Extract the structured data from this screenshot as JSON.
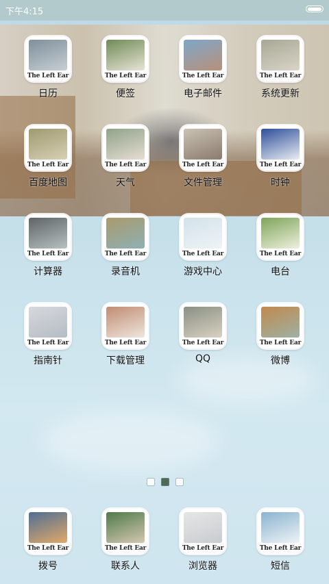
{
  "status_bar": {
    "time": "下午4:15"
  },
  "icon_caption": "The Left Ear",
  "apps": [
    {
      "id": "calendar",
      "label": "日历",
      "photo": [
        "#7f8f9a",
        "#c7cfd4"
      ]
    },
    {
      "id": "notes",
      "label": "便签",
      "photo": [
        "#6f8b56",
        "#e8e4d6"
      ]
    },
    {
      "id": "email",
      "label": "电子邮件",
      "photo": [
        "#7ea7c8",
        "#b9907a"
      ]
    },
    {
      "id": "system-update",
      "label": "系统更新",
      "photo": [
        "#a8a896",
        "#d8d4c6"
      ]
    },
    {
      "id": "baidu-map",
      "label": "百度地图",
      "photo": [
        "#a09a72",
        "#d7cfb4"
      ]
    },
    {
      "id": "weather",
      "label": "天气",
      "photo": [
        "#8fa38a",
        "#e6ddd2"
      ]
    },
    {
      "id": "file-manager",
      "label": "文件管理",
      "photo": [
        "#c9c2b4",
        "#8a7b6e"
      ]
    },
    {
      "id": "clock",
      "label": "时钟",
      "photo": [
        "#2e4f9a",
        "#e8ecf2"
      ]
    },
    {
      "id": "calculator",
      "label": "计算器",
      "photo": [
        "#5f6566",
        "#b8bfc0"
      ]
    },
    {
      "id": "recorder",
      "label": "录音机",
      "photo": [
        "#a99a6c",
        "#8fb0b4"
      ]
    },
    {
      "id": "game-center",
      "label": "游戏中心",
      "photo": [
        "#d4e2ea",
        "#eef3f6"
      ]
    },
    {
      "id": "radio",
      "label": "电台",
      "photo": [
        "#7ea45a",
        "#eef0de"
      ]
    },
    {
      "id": "compass",
      "label": "指南针",
      "photo": [
        "#d6d8dc",
        "#b6bcc4"
      ]
    },
    {
      "id": "download-manager",
      "label": "下载管理",
      "photo": [
        "#c08c72",
        "#efe6de"
      ]
    },
    {
      "id": "qq",
      "label": "QQ",
      "photo": [
        "#8a8f86",
        "#d8d2c0"
      ]
    },
    {
      "id": "weibo",
      "label": "微博",
      "photo": [
        "#c08a4e",
        "#9fb0a4"
      ]
    }
  ],
  "dock": [
    {
      "id": "dialer",
      "label": "拨号",
      "photo": [
        "#4f6f92",
        "#e2a86a"
      ]
    },
    {
      "id": "contacts",
      "label": "联系人",
      "photo": [
        "#4f7a4a",
        "#d4c7b2"
      ]
    },
    {
      "id": "browser",
      "label": "浏览器",
      "photo": [
        "#e6e6e6",
        "#c8cccf"
      ]
    },
    {
      "id": "messages",
      "label": "短信",
      "photo": [
        "#8ab3d0",
        "#eef3f6"
      ]
    }
  ],
  "page_indicator": {
    "pages": 3,
    "current": 2
  },
  "colors": {
    "label_text": "#111111",
    "status_text": "#ffffff"
  }
}
